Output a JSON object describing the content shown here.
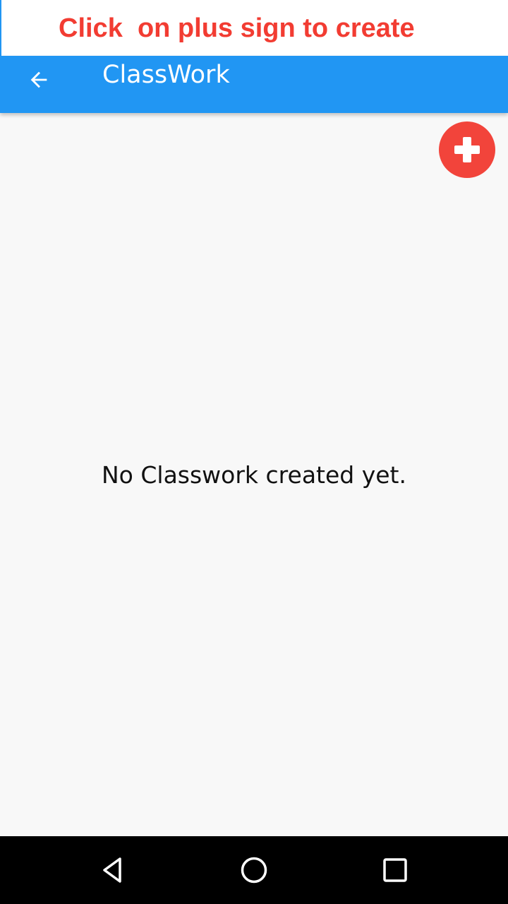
{
  "instruction": {
    "text": "Click  on plus sign to create",
    "color": "#f23c32"
  },
  "app_bar": {
    "title": "ClassWork",
    "back_icon": "arrow-left-icon",
    "color": "#2196f3"
  },
  "fab": {
    "icon": "plus-icon",
    "color": "#f2443b"
  },
  "main": {
    "empty_message": "No Classwork created yet."
  },
  "system_nav": {
    "back_icon": "triangle-back-icon",
    "home_icon": "circle-home-icon",
    "recents_icon": "square-recents-icon"
  }
}
